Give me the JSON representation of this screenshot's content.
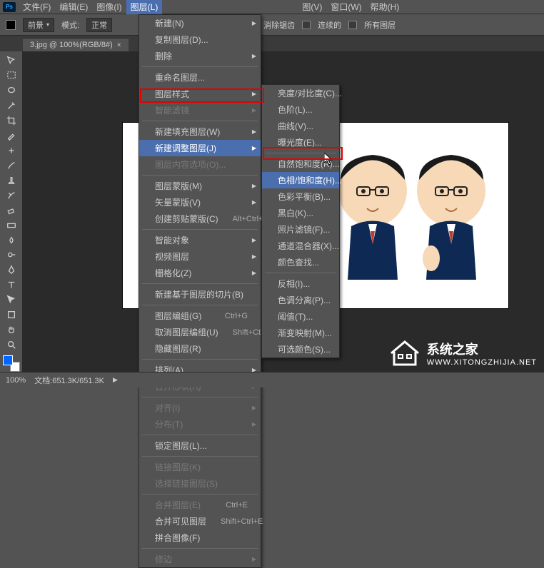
{
  "menubar": {
    "items": [
      "文件(F)",
      "编辑(E)",
      "图像(I)",
      "图层(L)",
      "",
      "",
      "",
      "图(V)",
      "窗口(W)",
      "帮助(H)"
    ],
    "active_index": 3
  },
  "optionbar": {
    "label1": "前景",
    "label2": "模式:",
    "mode": "正常",
    "opt1": "消除锯齿",
    "opt2": "连续的",
    "opt3": "所有图层"
  },
  "tab": {
    "title": "3.jpg @ 100%(RGB/8#)"
  },
  "status": {
    "zoom": "100%",
    "doc": "文档:651.3K/651.3K"
  },
  "menu1": [
    {
      "t": "row",
      "label": "新建(N)",
      "sub": true
    },
    {
      "t": "row",
      "label": "复制图层(D)..."
    },
    {
      "t": "row",
      "label": "删除",
      "sub": true
    },
    {
      "t": "sep"
    },
    {
      "t": "row",
      "label": "重命名图层..."
    },
    {
      "t": "row",
      "label": "图层样式",
      "sub": true
    },
    {
      "t": "row",
      "label": "智能滤镜",
      "sub": true,
      "disabled": true
    },
    {
      "t": "sep"
    },
    {
      "t": "row",
      "label": "新建填充图层(W)",
      "sub": true
    },
    {
      "t": "row",
      "label": "新建调整图层(J)",
      "sub": true,
      "hover": true
    },
    {
      "t": "row",
      "label": "图层内容选项(O)...",
      "disabled": true
    },
    {
      "t": "sep"
    },
    {
      "t": "row",
      "label": "图层蒙版(M)",
      "sub": true
    },
    {
      "t": "row",
      "label": "矢量蒙版(V)",
      "sub": true
    },
    {
      "t": "row",
      "label": "创建剪贴蒙版(C)",
      "shortcut": "Alt+Ctrl+G"
    },
    {
      "t": "sep"
    },
    {
      "t": "row",
      "label": "智能对象",
      "sub": true
    },
    {
      "t": "row",
      "label": "视频图层",
      "sub": true
    },
    {
      "t": "row",
      "label": "栅格化(Z)",
      "sub": true
    },
    {
      "t": "sep"
    },
    {
      "t": "row",
      "label": "新建基于图层的切片(B)"
    },
    {
      "t": "sep"
    },
    {
      "t": "row",
      "label": "图层编组(G)",
      "shortcut": "Ctrl+G"
    },
    {
      "t": "row",
      "label": "取消图层编组(U)",
      "shortcut": "Shift+Ctrl+G"
    },
    {
      "t": "row",
      "label": "隐藏图层(R)"
    },
    {
      "t": "sep"
    },
    {
      "t": "row",
      "label": "排列(A)",
      "sub": true
    },
    {
      "t": "row",
      "label": "合并形状(H)",
      "sub": true,
      "disabled": true
    },
    {
      "t": "sep"
    },
    {
      "t": "row",
      "label": "对齐(I)",
      "sub": true,
      "disabled": true
    },
    {
      "t": "row",
      "label": "分布(T)",
      "sub": true,
      "disabled": true
    },
    {
      "t": "sep"
    },
    {
      "t": "row",
      "label": "锁定图层(L)..."
    },
    {
      "t": "sep"
    },
    {
      "t": "row",
      "label": "链接图层(K)",
      "disabled": true
    },
    {
      "t": "row",
      "label": "选择链接图层(S)",
      "disabled": true
    },
    {
      "t": "sep"
    },
    {
      "t": "row",
      "label": "合并图层(E)",
      "shortcut": "Ctrl+E",
      "disabled": true
    },
    {
      "t": "row",
      "label": "合并可见图层",
      "shortcut": "Shift+Ctrl+E"
    },
    {
      "t": "row",
      "label": "拼合图像(F)"
    },
    {
      "t": "sep"
    },
    {
      "t": "row",
      "label": "修边",
      "sub": true,
      "disabled": true
    }
  ],
  "menu2": [
    {
      "t": "row",
      "label": "亮度/对比度(C)..."
    },
    {
      "t": "row",
      "label": "色阶(L)..."
    },
    {
      "t": "row",
      "label": "曲线(V)..."
    },
    {
      "t": "row",
      "label": "曝光度(E)..."
    },
    {
      "t": "sep"
    },
    {
      "t": "row",
      "label": "自然饱和度(R)..."
    },
    {
      "t": "row",
      "label": "色相/饱和度(H)...",
      "hover": true
    },
    {
      "t": "row",
      "label": "色彩平衡(B)..."
    },
    {
      "t": "row",
      "label": "黑白(K)..."
    },
    {
      "t": "row",
      "label": "照片滤镜(F)..."
    },
    {
      "t": "row",
      "label": "通道混合器(X)..."
    },
    {
      "t": "row",
      "label": "颜色查找..."
    },
    {
      "t": "sep"
    },
    {
      "t": "row",
      "label": "反相(I)..."
    },
    {
      "t": "row",
      "label": "色调分离(P)..."
    },
    {
      "t": "row",
      "label": "阈值(T)..."
    },
    {
      "t": "row",
      "label": "渐变映射(M)..."
    },
    {
      "t": "row",
      "label": "可选颜色(S)..."
    }
  ],
  "watermark": {
    "name": "系统之家",
    "url": "WWW.XITONGZHIJIA.NET"
  }
}
